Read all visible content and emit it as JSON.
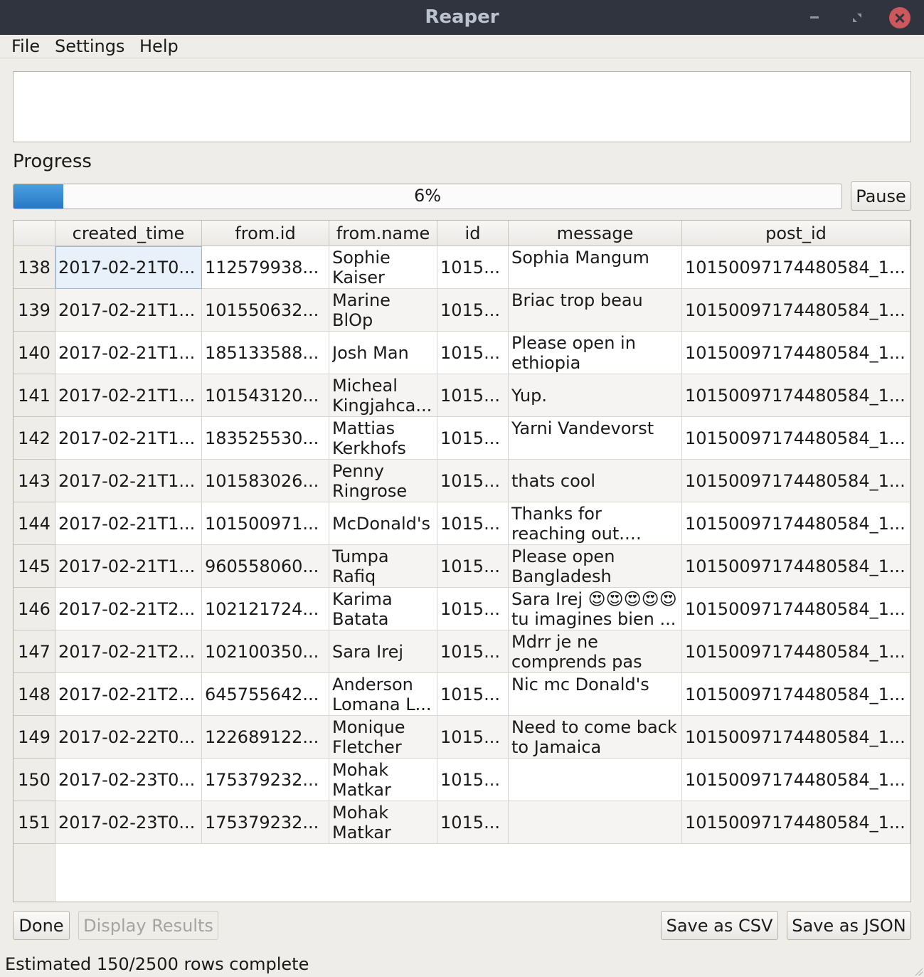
{
  "window": {
    "title": "Reaper"
  },
  "menu": [
    "File",
    "Settings",
    "Help"
  ],
  "progress": {
    "label": "Progress",
    "percent": 6,
    "text": "6%",
    "pause_label": "Pause"
  },
  "table": {
    "columns": [
      "created_time",
      "from.id",
      "from.name",
      "id",
      "message",
      "post_id"
    ],
    "selected_row": 0,
    "selected_col": 0,
    "rows": [
      {
        "num": "138",
        "created_time": "2017-02-21T0...",
        "from_id": "112579938...",
        "from_name": "Sophie Kaiser",
        "id": "1015...",
        "message": "Sophia Mangum",
        "post_id": "10150097174480584_1..."
      },
      {
        "num": "139",
        "created_time": "2017-02-21T1...",
        "from_id": "101550632...",
        "from_name": "Marine BlOp",
        "id": "1015...",
        "message": "Briac trop beau",
        "post_id": "10150097174480584_1..."
      },
      {
        "num": "140",
        "created_time": "2017-02-21T1...",
        "from_id": "185133588...",
        "from_name": "Josh Man",
        "id": "1015...",
        "message": "Please open in ethiopia",
        "post_id": "10150097174480584_1..."
      },
      {
        "num": "141",
        "created_time": "2017-02-21T1...",
        "from_id": "101543120...",
        "from_name": "Micheal Kingjahca...",
        "id": "1015...",
        "message": "Yup.",
        "post_id": "10150097174480584_1..."
      },
      {
        "num": "142",
        "created_time": "2017-02-21T1...",
        "from_id": "183525530...",
        "from_name": "Mattias Kerkhofs",
        "id": "1015...",
        "message": "Yarni Vandevorst",
        "post_id": "10150097174480584_1..."
      },
      {
        "num": "143",
        "created_time": "2017-02-21T1...",
        "from_id": "101583026...",
        "from_name": "Penny Ringrose",
        "id": "1015...",
        "message": "thats cool",
        "post_id": "10150097174480584_1..."
      },
      {
        "num": "144",
        "created_time": "2017-02-21T1...",
        "from_id": "101500971...",
        "from_name": "McDonald's",
        "id": "1015...",
        "message": "Thanks for reaching out. Whi...",
        "post_id": "10150097174480584_1..."
      },
      {
        "num": "145",
        "created_time": "2017-02-21T1...",
        "from_id": "960558060...",
        "from_name": "Tumpa Rafiq",
        "id": "1015...",
        "message": "Please open Bangladesh",
        "post_id": "10150097174480584_1..."
      },
      {
        "num": "146",
        "created_time": "2017-02-21T2...",
        "from_id": "102121724...",
        "from_name": "Karima Batata",
        "id": "1015...",
        "message": "Sara Irej 😍😍😍😍😍 tu imagines bien ...",
        "post_id": "10150097174480584_1..."
      },
      {
        "num": "147",
        "created_time": "2017-02-21T2...",
        "from_id": "102100350...",
        "from_name": "Sara Irej",
        "id": "1015...",
        "message": "Mdrr je ne comprends pas",
        "post_id": "10150097174480584_1..."
      },
      {
        "num": "148",
        "created_time": "2017-02-21T2...",
        "from_id": "645755642...",
        "from_name": "Anderson Lomana L...",
        "id": "1015...",
        "message": "Nic mc Donald's",
        "post_id": "10150097174480584_1..."
      },
      {
        "num": "149",
        "created_time": "2017-02-22T0...",
        "from_id": "122689122...",
        "from_name": "Monique Fletcher",
        "id": "1015...",
        "message": "Need to come back to Jamaica",
        "post_id": "10150097174480584_1..."
      },
      {
        "num": "150",
        "created_time": "2017-02-23T0...",
        "from_id": "175379232...",
        "from_name": "Mohak Matkar",
        "id": "1015...",
        "message": "",
        "post_id": "10150097174480584_1..."
      },
      {
        "num": "151",
        "created_time": "2017-02-23T0...",
        "from_id": "175379232...",
        "from_name": "Mohak Matkar",
        "id": "1015...",
        "message": "",
        "post_id": "10150097174480584_1..."
      }
    ]
  },
  "buttons": {
    "done": "Done",
    "display_results": "Display Results",
    "save_csv": "Save as CSV",
    "save_json": "Save as JSON"
  },
  "status": "Estimated 150/2500 rows complete"
}
